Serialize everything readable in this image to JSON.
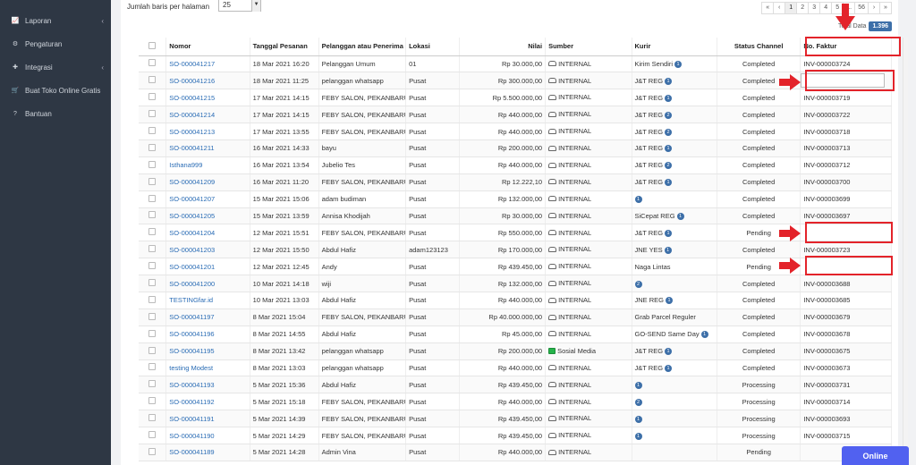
{
  "sidebar": {
    "items": [
      {
        "label": "Laporan",
        "icon": "chart-line-icon",
        "has_chevron": true
      },
      {
        "label": "Pengaturan",
        "icon": "gears-icon",
        "has_chevron": false
      },
      {
        "label": "Integrasi",
        "icon": "puzzle-icon",
        "has_chevron": true
      },
      {
        "label": "Buat Toko Online Gratis",
        "icon": "cart-icon",
        "has_chevron": false
      },
      {
        "label": "Bantuan",
        "icon": "question-circle-icon",
        "has_chevron": false
      }
    ]
  },
  "toolbar": {
    "rows_per_page_label": "Jumlah baris per halaman",
    "rows_per_page_value": "25"
  },
  "pagination": {
    "first": "«",
    "prev": "‹",
    "pages": [
      "1",
      "2",
      "3",
      "4",
      "5"
    ],
    "ellipsis": "...",
    "last_page": "56",
    "next": "›",
    "last": "»",
    "current": "1"
  },
  "total": {
    "label": "Total Data",
    "value": "1.396"
  },
  "table": {
    "headers": [
      "",
      "Nomor",
      "Tanggal Pesanan",
      "Pelanggan atau Penerima",
      "Lokasi",
      "Nilai",
      "Sumber",
      "Kurir",
      "Status Channel",
      "No. Faktur"
    ],
    "rows": [
      {
        "no": "SO-000041217",
        "date": "18 Mar 2021 16:20",
        "customer": "Pelanggan Umum",
        "loc": "01",
        "value": "Rp 30.000,00",
        "source": "INTERNAL",
        "src_type": "internal",
        "courier": "Kirim Sendiri",
        "cbadge": "1",
        "status": "Completed",
        "invoice": "INV-000003724",
        "empty": false
      },
      {
        "no": "SO-000041216",
        "date": "18 Mar 2021 11:25",
        "customer": "pelanggan whatsapp",
        "loc": "Pusat",
        "value": "Rp 300.000,00",
        "source": "INTERNAL",
        "src_type": "internal",
        "courier": "J&T REG",
        "cbadge": "1",
        "status": "Completed",
        "invoice": "",
        "empty": true
      },
      {
        "no": "SO-000041215",
        "date": "17 Mar 2021 14:15",
        "customer": "FEBY SALON, PEKANBARU",
        "loc": "Pusat",
        "value": "Rp 5.500.000,00",
        "source": "INTERNAL",
        "src_type": "internal",
        "courier": "J&T REG",
        "cbadge": "1",
        "status": "Completed",
        "invoice": "INV-000003719",
        "empty": false
      },
      {
        "no": "SO-000041214",
        "date": "17 Mar 2021 14:15",
        "customer": "FEBY SALON, PEKANBARU",
        "loc": "Pusat",
        "value": "Rp 440.000,00",
        "source": "INTERNAL",
        "src_type": "internal",
        "courier": "J&T REG",
        "cbadge": "2",
        "status": "Completed",
        "invoice": "INV-000003722",
        "empty": false
      },
      {
        "no": "SO-000041213",
        "date": "17 Mar 2021 13:55",
        "customer": "FEBY SALON, PEKANBARU",
        "loc": "Pusat",
        "value": "Rp 440.000,00",
        "source": "INTERNAL",
        "src_type": "internal",
        "courier": "J&T REG",
        "cbadge": "2",
        "status": "Completed",
        "invoice": "INV-000003718",
        "empty": false
      },
      {
        "no": "SO-000041211",
        "date": "16 Mar 2021 14:33",
        "customer": "bayu",
        "loc": "Pusat",
        "value": "Rp 200.000,00",
        "source": "INTERNAL",
        "src_type": "internal",
        "courier": "J&T REG",
        "cbadge": "1",
        "status": "Completed",
        "invoice": "INV-000003713",
        "empty": false
      },
      {
        "no": "Isthana999",
        "date": "16 Mar 2021 13:54",
        "customer": "Jubelio Tes",
        "loc": "Pusat",
        "value": "Rp 440.000,00",
        "source": "INTERNAL",
        "src_type": "internal",
        "courier": "J&T REG",
        "cbadge": "2",
        "status": "Completed",
        "invoice": "INV-000003712",
        "empty": false
      },
      {
        "no": "SO-000041209",
        "date": "16 Mar 2021 11:20",
        "customer": "FEBY SALON, PEKANBARU",
        "loc": "Pusat",
        "value": "Rp 12.222,10",
        "source": "INTERNAL",
        "src_type": "internal",
        "courier": "J&T REG",
        "cbadge": "1",
        "status": "Completed",
        "invoice": "INV-000003700",
        "empty": false
      },
      {
        "no": "SO-000041207",
        "date": "15 Mar 2021 15:06",
        "customer": "adam budiman",
        "loc": "Pusat",
        "value": "Rp 132.000,00",
        "source": "INTERNAL",
        "src_type": "internal",
        "courier": "",
        "cbadge": "1",
        "status": "Completed",
        "invoice": "INV-000003699",
        "empty": false
      },
      {
        "no": "SO-000041205",
        "date": "15 Mar 2021 13:59",
        "customer": "Annisa Khodijah",
        "loc": "Pusat",
        "value": "Rp 30.000,00",
        "source": "INTERNAL",
        "src_type": "internal",
        "courier": "SiCepat REG",
        "cbadge": "1",
        "status": "Completed",
        "invoice": "INV-000003697",
        "empty": false
      },
      {
        "no": "SO-000041204",
        "date": "12 Mar 2021 15:51",
        "customer": "FEBY SALON, PEKANBARU",
        "loc": "Pusat",
        "value": "Rp 550.000,00",
        "source": "INTERNAL",
        "src_type": "internal",
        "courier": "J&T REG",
        "cbadge": "1",
        "status": "Pending",
        "invoice": "",
        "empty": false
      },
      {
        "no": "SO-000041203",
        "date": "12 Mar 2021 15:50",
        "customer": "Abdul Hafiz",
        "loc": "adam123123",
        "value": "Rp 170.000,00",
        "source": "INTERNAL",
        "src_type": "internal",
        "courier": "JNE YES",
        "cbadge": "1",
        "status": "Completed",
        "invoice": "INV-000003723",
        "empty": false
      },
      {
        "no": "SO-000041201",
        "date": "12 Mar 2021 12:45",
        "customer": "Andy",
        "loc": "Pusat",
        "value": "Rp 439.450,00",
        "source": "INTERNAL",
        "src_type": "internal",
        "courier": "Naga Lintas",
        "cbadge": "",
        "status": "Pending",
        "invoice": "",
        "empty": false
      },
      {
        "no": "SO-000041200",
        "date": "10 Mar 2021 14:18",
        "customer": "wiji",
        "loc": "Pusat",
        "value": "Rp 132.000,00",
        "source": "INTERNAL",
        "src_type": "internal",
        "courier": "",
        "cbadge": "2",
        "status": "Completed",
        "invoice": "INV-000003688",
        "empty": false
      },
      {
        "no": "TESTINGfar.id",
        "date": "10 Mar 2021 13:03",
        "customer": "Abdul Hafiz",
        "loc": "Pusat",
        "value": "Rp 440.000,00",
        "source": "INTERNAL",
        "src_type": "internal",
        "courier": "JNE REG",
        "cbadge": "1",
        "status": "Completed",
        "invoice": "INV-000003685",
        "empty": false
      },
      {
        "no": "SO-000041197",
        "date": "8 Mar 2021 15:04",
        "customer": "FEBY SALON, PEKANBARU",
        "loc": "Pusat",
        "value": "Rp 40.000.000,00",
        "source": "INTERNAL",
        "src_type": "internal",
        "courier": "Grab Parcel Reguler",
        "cbadge": "",
        "status": "Completed",
        "invoice": "INV-000003679",
        "empty": false
      },
      {
        "no": "SO-000041196",
        "date": "8 Mar 2021 14:55",
        "customer": "Abdul Hafiz",
        "loc": "Pusat",
        "value": "Rp 45.000,00",
        "source": "INTERNAL",
        "src_type": "internal",
        "courier": "GO-SEND Same Day",
        "cbadge": "1",
        "status": "Completed",
        "invoice": "INV-000003678",
        "empty": false
      },
      {
        "no": "SO-000041195",
        "date": "8 Mar 2021 13:42",
        "customer": "pelanggan whatsapp",
        "loc": "Pusat",
        "value": "Rp 200.000,00",
        "source": "Sosial Media",
        "src_type": "social",
        "courier": "J&T REG",
        "cbadge": "1",
        "status": "Completed",
        "invoice": "INV-000003675",
        "empty": false
      },
      {
        "no": "testing Modest",
        "date": "8 Mar 2021 13:03",
        "customer": "pelanggan whatsapp",
        "loc": "Pusat",
        "value": "Rp 440.000,00",
        "source": "INTERNAL",
        "src_type": "internal",
        "courier": "J&T REG",
        "cbadge": "1",
        "status": "Completed",
        "invoice": "INV-000003673",
        "empty": false
      },
      {
        "no": "SO-000041193",
        "date": "5 Mar 2021 15:36",
        "customer": "Abdul Hafiz",
        "loc": "Pusat",
        "value": "Rp 439.450,00",
        "source": "INTERNAL",
        "src_type": "internal",
        "courier": "",
        "cbadge": "1",
        "status": "Processing",
        "invoice": "INV-000003731",
        "empty": false
      },
      {
        "no": "SO-000041192",
        "date": "5 Mar 2021 15:18",
        "customer": "FEBY SALON, PEKANBARU",
        "loc": "Pusat",
        "value": "Rp 440.000,00",
        "source": "INTERNAL",
        "src_type": "internal",
        "courier": "",
        "cbadge": "2",
        "status": "Processing",
        "invoice": "INV-000003714",
        "empty": false
      },
      {
        "no": "SO-000041191",
        "date": "5 Mar 2021 14:39",
        "customer": "FEBY SALON, PEKANBARU",
        "loc": "Pusat",
        "value": "Rp 439.450,00",
        "source": "INTERNAL",
        "src_type": "internal",
        "courier": "",
        "cbadge": "1",
        "status": "Processing",
        "invoice": "INV-000003693",
        "empty": false
      },
      {
        "no": "SO-000041190",
        "date": "5 Mar 2021 14:29",
        "customer": "FEBY SALON, PEKANBARU",
        "loc": "Pusat",
        "value": "Rp 439.450,00",
        "source": "INTERNAL",
        "src_type": "internal",
        "courier": "",
        "cbadge": "1",
        "status": "Processing",
        "invoice": "INV-000003715",
        "empty": false
      },
      {
        "no": "SO-000041189",
        "date": "5 Mar 2021 14:28",
        "customer": "Admin Vina",
        "loc": "Pusat",
        "value": "Rp 440.000,00",
        "source": "INTERNAL",
        "src_type": "internal",
        "courier": "",
        "cbadge": "",
        "status": "Pending",
        "invoice": "",
        "empty": false
      }
    ]
  },
  "chat": {
    "label": "Online"
  },
  "colors": {
    "sidebar_bg": "#2e3744",
    "link": "#2a6cb5",
    "badge": "#3d6fa8",
    "highlight": "#e3232a",
    "chat": "#5161f0"
  }
}
